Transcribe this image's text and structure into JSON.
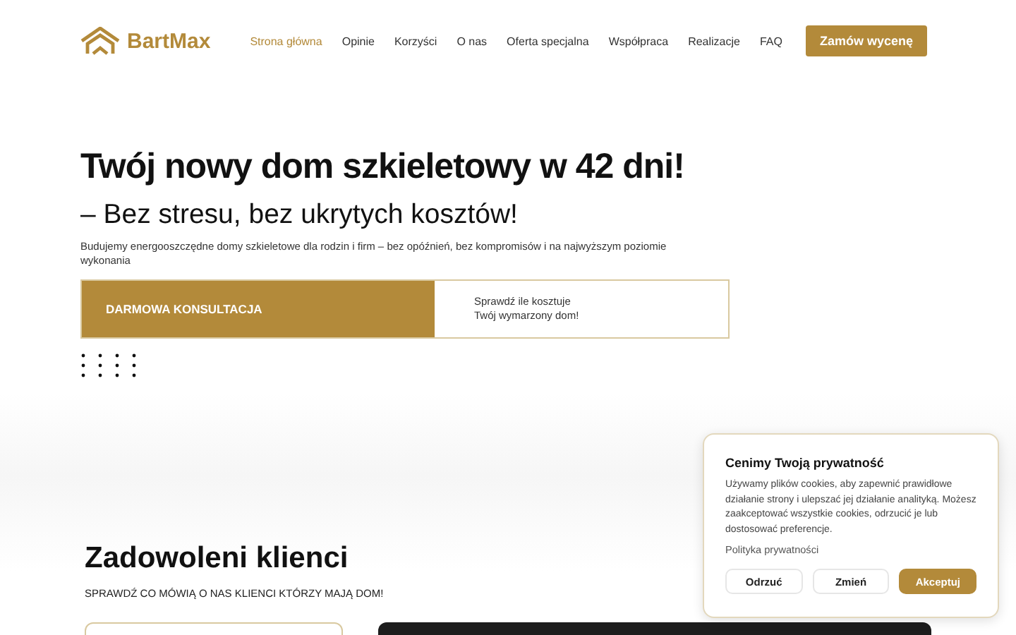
{
  "header": {
    "logo": "BartMax",
    "nav": [
      {
        "label": "Strona główna",
        "selected": true
      },
      {
        "label": "Opinie",
        "selected": false
      },
      {
        "label": "Korzyści",
        "selected": false
      },
      {
        "label": "O nas",
        "selected": false
      },
      {
        "label": "Oferta specjalna",
        "selected": false
      },
      {
        "label": "Współpraca",
        "selected": false
      },
      {
        "label": "Realizacje",
        "selected": false
      },
      {
        "label": "FAQ",
        "selected": false
      }
    ],
    "cta": "Zamów wycenę"
  },
  "hero": {
    "title": "Twój nowy dom szkieletowy w 42 dni!",
    "subtitle": "– Bez stresu, bez ukrytych kosztów!",
    "description": "Budujemy energooszczędne domy szkieletowe dla rodzin i firm – bez opóźnień, bez kompromisów i na najwyższym poziomie wykonania",
    "consult_button": "DARMOWA KONSULTACJA",
    "price_lines": [
      "Sprawdź ile kosztuje",
      "Twój wymarzony dom!"
    ]
  },
  "testimonials": {
    "title": "Zadowoleni klienci",
    "subtitle": "SPRAWDŹ CO MÓWIĄ O NAS KLIENCI KTÓRZY MAJĄ DOM!"
  },
  "cookie_banner": {
    "title": "Cenimy Twoją prywatność",
    "text": "Używamy plików cookies, aby zapewnić prawidłowe działanie strony i ulepszać jej działanie analityką. Możesz zaakceptować wszystkie cookies, odrzucić je lub dostosować preferencje.",
    "policy_link": "Polityka prywatności",
    "buttons": [
      {
        "label": "Odrzuć",
        "kind": "secondary"
      },
      {
        "label": "Zmień",
        "kind": "secondary"
      },
      {
        "label": "Akceptuj",
        "kind": "primary"
      }
    ]
  }
}
